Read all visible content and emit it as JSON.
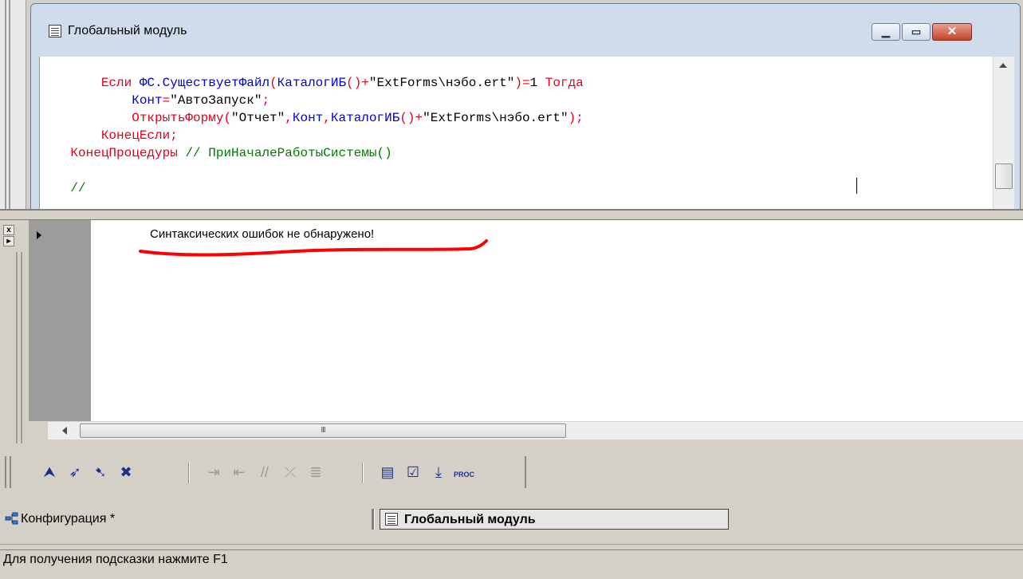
{
  "module_window": {
    "title": "Глобальный модуль",
    "code_lines": [
      [
        {
          "t": "        "
        },
        {
          "c": "kw",
          "t": "Если"
        },
        {
          "t": " "
        },
        {
          "c": "id",
          "t": "ФС.СуществуетФайл"
        },
        {
          "c": "kw",
          "t": "("
        },
        {
          "c": "id",
          "t": "КаталогИБ"
        },
        {
          "c": "kw",
          "t": "()+"
        },
        {
          "c": "str",
          "t": "\"ExtForms\\нэбо.ert\""
        },
        {
          "c": "kw",
          "t": ")="
        },
        {
          "c": "str",
          "t": "1"
        },
        {
          "t": " "
        },
        {
          "c": "kw",
          "t": "Тогда"
        }
      ],
      [
        {
          "t": "            "
        },
        {
          "c": "id",
          "t": "Конт"
        },
        {
          "c": "kw",
          "t": "="
        },
        {
          "c": "str",
          "t": "\"АвтоЗапуск\""
        },
        {
          "c": "kw",
          "t": ";"
        }
      ],
      [
        {
          "t": "            "
        },
        {
          "c": "kw",
          "t": "ОткрытьФорму("
        },
        {
          "c": "str",
          "t": "\"Отчет\""
        },
        {
          "c": "kw",
          "t": ","
        },
        {
          "c": "id",
          "t": "Конт"
        },
        {
          "c": "kw",
          "t": ","
        },
        {
          "c": "id",
          "t": "КаталогИБ"
        },
        {
          "c": "kw",
          "t": "()+"
        },
        {
          "c": "str",
          "t": "\"ExtForms\\нэбо.ert\""
        },
        {
          "c": "kw",
          "t": ");"
        }
      ],
      [
        {
          "t": "        "
        },
        {
          "c": "kw",
          "t": "КонецЕсли;"
        }
      ],
      [
        {
          "t": "    "
        },
        {
          "c": "kw",
          "t": "КонецПроцедуры"
        },
        {
          "t": " "
        },
        {
          "c": "cm",
          "t": "// ПриНачалеРаботыСистемы()"
        }
      ],
      [
        {
          "t": ""
        }
      ],
      [
        {
          "t": "    "
        },
        {
          "c": "cm",
          "t": "//"
        }
      ]
    ]
  },
  "messages": {
    "items": [
      "Синтаксических ошибок не обнаружено!"
    ],
    "close_glyph": "x",
    "scroll_grip": "III",
    "underline_color": "#ff0000"
  },
  "toolbar": {
    "buttons": [
      {
        "icon": "bookmark-toggle-icon",
        "glyph": "⮝",
        "enabled": true
      },
      {
        "icon": "bookmark-next-icon",
        "glyph": "➶",
        "enabled": true
      },
      {
        "icon": "bookmark-prev-icon",
        "glyph": "➷",
        "enabled": true
      },
      {
        "icon": "bookmark-clear-icon",
        "glyph": "✖",
        "enabled": true
      },
      {
        "icon": "indent-icon",
        "glyph": "⇥",
        "enabled": false
      },
      {
        "icon": "outdent-icon",
        "glyph": "⇤",
        "enabled": false
      },
      {
        "icon": "comment-icon",
        "glyph": "//",
        "enabled": false
      },
      {
        "icon": "uncomment-icon",
        "glyph": "⤫",
        "enabled": false
      },
      {
        "icon": "format-icon",
        "glyph": "≣",
        "enabled": false
      },
      {
        "icon": "syntax-check-icon",
        "glyph": "▤",
        "enabled": true
      },
      {
        "icon": "compile-icon",
        "glyph": "☑",
        "enabled": true
      },
      {
        "icon": "goto-line-icon",
        "glyph": "⤓",
        "enabled": true
      },
      {
        "icon": "procedures-icon",
        "glyph": "PROC",
        "enabled": true
      }
    ]
  },
  "window_tabs": [
    {
      "label": "Конфигурация *",
      "icon": "configuration-tree-icon",
      "active": false
    },
    {
      "label": "Глобальный модуль",
      "icon": "module-icon",
      "active": true
    }
  ],
  "status_bar": {
    "text": "Для получения подсказки нажмите F1"
  }
}
